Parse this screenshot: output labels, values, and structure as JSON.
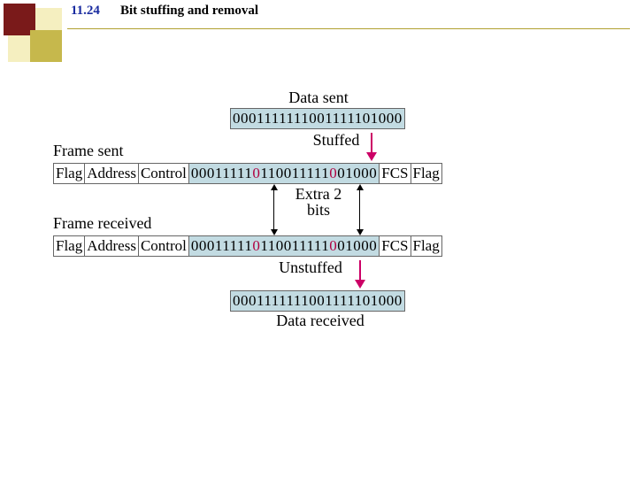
{
  "header": {
    "figure_number": "11.24",
    "figure_title": "Bit stuffing and removal"
  },
  "labels": {
    "data_sent": "Data sent",
    "stuffed": "Stuffed",
    "frame_sent": "Frame sent",
    "extra_bits": "Extra 2 bits",
    "frame_received": "Frame received",
    "unstuffed": "Unstuffed",
    "data_received": "Data received"
  },
  "fields": {
    "flag": "Flag",
    "address": "Address",
    "control": "Control",
    "fcs": "FCS"
  },
  "bits": {
    "original": "0001111111001111101000",
    "stuffed_pre": "00011111",
    "stuffed_s1": "0",
    "stuffed_mid": "110011111",
    "stuffed_s2": "0",
    "stuffed_post": "01000"
  }
}
